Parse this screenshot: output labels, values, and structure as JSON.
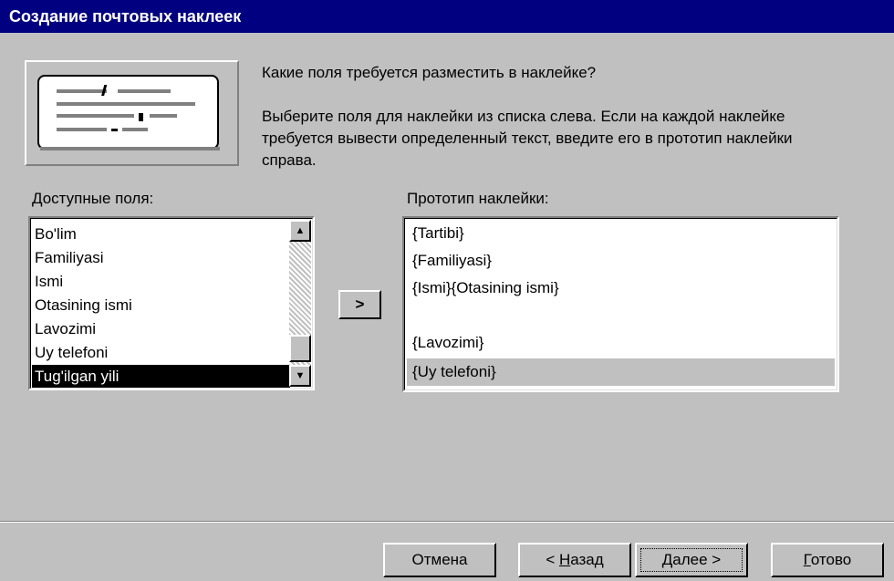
{
  "window": {
    "title": "Создание почтовых наклеек"
  },
  "intro": {
    "question": "Какие поля требуется разместить в наклейке?",
    "description": "Выберите поля для наклейки из списка слева. Если на каждой наклейке требуется вывести определенный текст, введите его в прототип наклейки справа."
  },
  "available_fields": {
    "label": "Доступные поля:",
    "items": [
      "Bo'lim",
      "Familiyasi",
      "Ismi",
      "Otasining ismi",
      "Lavozimi",
      "Uy telefoni",
      "Tug'ilgan yili"
    ],
    "selected": "Tug'ilgan yili"
  },
  "add_button": {
    "label": ">"
  },
  "prototype": {
    "label": "Прототип наклейки:",
    "lines": [
      "{Tartibi}",
      "{Familiyasi}",
      "{Ismi}{Otasining ismi}",
      "",
      "{Lavozimi}",
      "{Uy telefoni}"
    ],
    "current_line": "{Uy telefoni}"
  },
  "footer": {
    "cancel": "Отмена",
    "back_prefix": "< ",
    "back_accel": "Н",
    "back_rest": "азад",
    "next_accel": "Д",
    "next_rest": "алее >",
    "finish_accel": "Г",
    "finish_rest": "отово"
  },
  "illustration_icon": "mailing-label-icon"
}
